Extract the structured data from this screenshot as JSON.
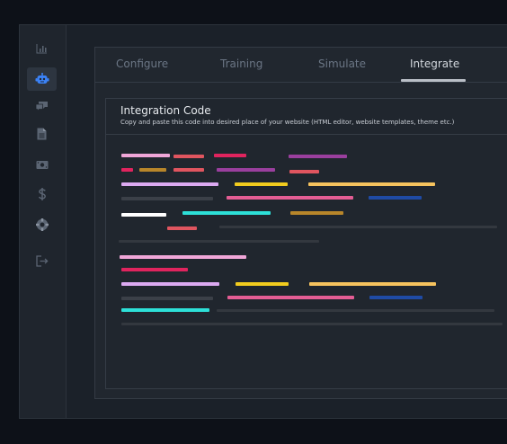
{
  "sidebar": {
    "items": [
      {
        "name": "sidebar-item-analytics",
        "icon": "bar-chart-icon",
        "active": false
      },
      {
        "name": "sidebar-item-bots",
        "icon": "robot-icon",
        "active": true
      },
      {
        "name": "sidebar-item-conversations",
        "icon": "chat-bubbles-icon",
        "active": false
      },
      {
        "name": "sidebar-item-documents",
        "icon": "document-icon",
        "active": false
      },
      {
        "name": "sidebar-item-billing",
        "icon": "money-icon",
        "active": false
      },
      {
        "name": "sidebar-item-pricing",
        "icon": "dollar-icon",
        "active": false
      },
      {
        "name": "sidebar-item-support",
        "icon": "lifebuoy-icon",
        "active": false
      },
      {
        "name": "sidebar-item-logout",
        "icon": "logout-icon",
        "active": false
      }
    ]
  },
  "tabs": [
    {
      "label": "Configure",
      "active": false
    },
    {
      "label": "Training",
      "active": false
    },
    {
      "label": "Simulate",
      "active": false
    },
    {
      "label": "Integrate",
      "active": true
    }
  ],
  "integration": {
    "title": "Integration Code",
    "subtitle": "Copy and paste this code into desired place of your website (HTML editor, website templates, theme etc.)"
  },
  "colors": {
    "page_background": "#0d1118",
    "sidebar_icon": "#5b6573",
    "active_icon": "#3b82f6",
    "tab_active_text": "#d3d8de",
    "tab_inactive_text": "#6b7685",
    "code_pink_light": "#f0a6d8",
    "code_salmon": "#e0555f",
    "code_crimson": "#e0245e",
    "code_purple": "#9a3f9e",
    "code_gold": "#b8862a",
    "code_lavender": "#dcaaf2",
    "code_yellow": "#f2cc1e",
    "code_light_orange": "#f6c35e",
    "code_gray": "#3b4048",
    "code_pink": "#e45d94",
    "code_blue": "#1f4ba5",
    "code_white": "#ffffff",
    "code_cyan": "#2de0d8",
    "code_dim_gray": "#33383f"
  }
}
